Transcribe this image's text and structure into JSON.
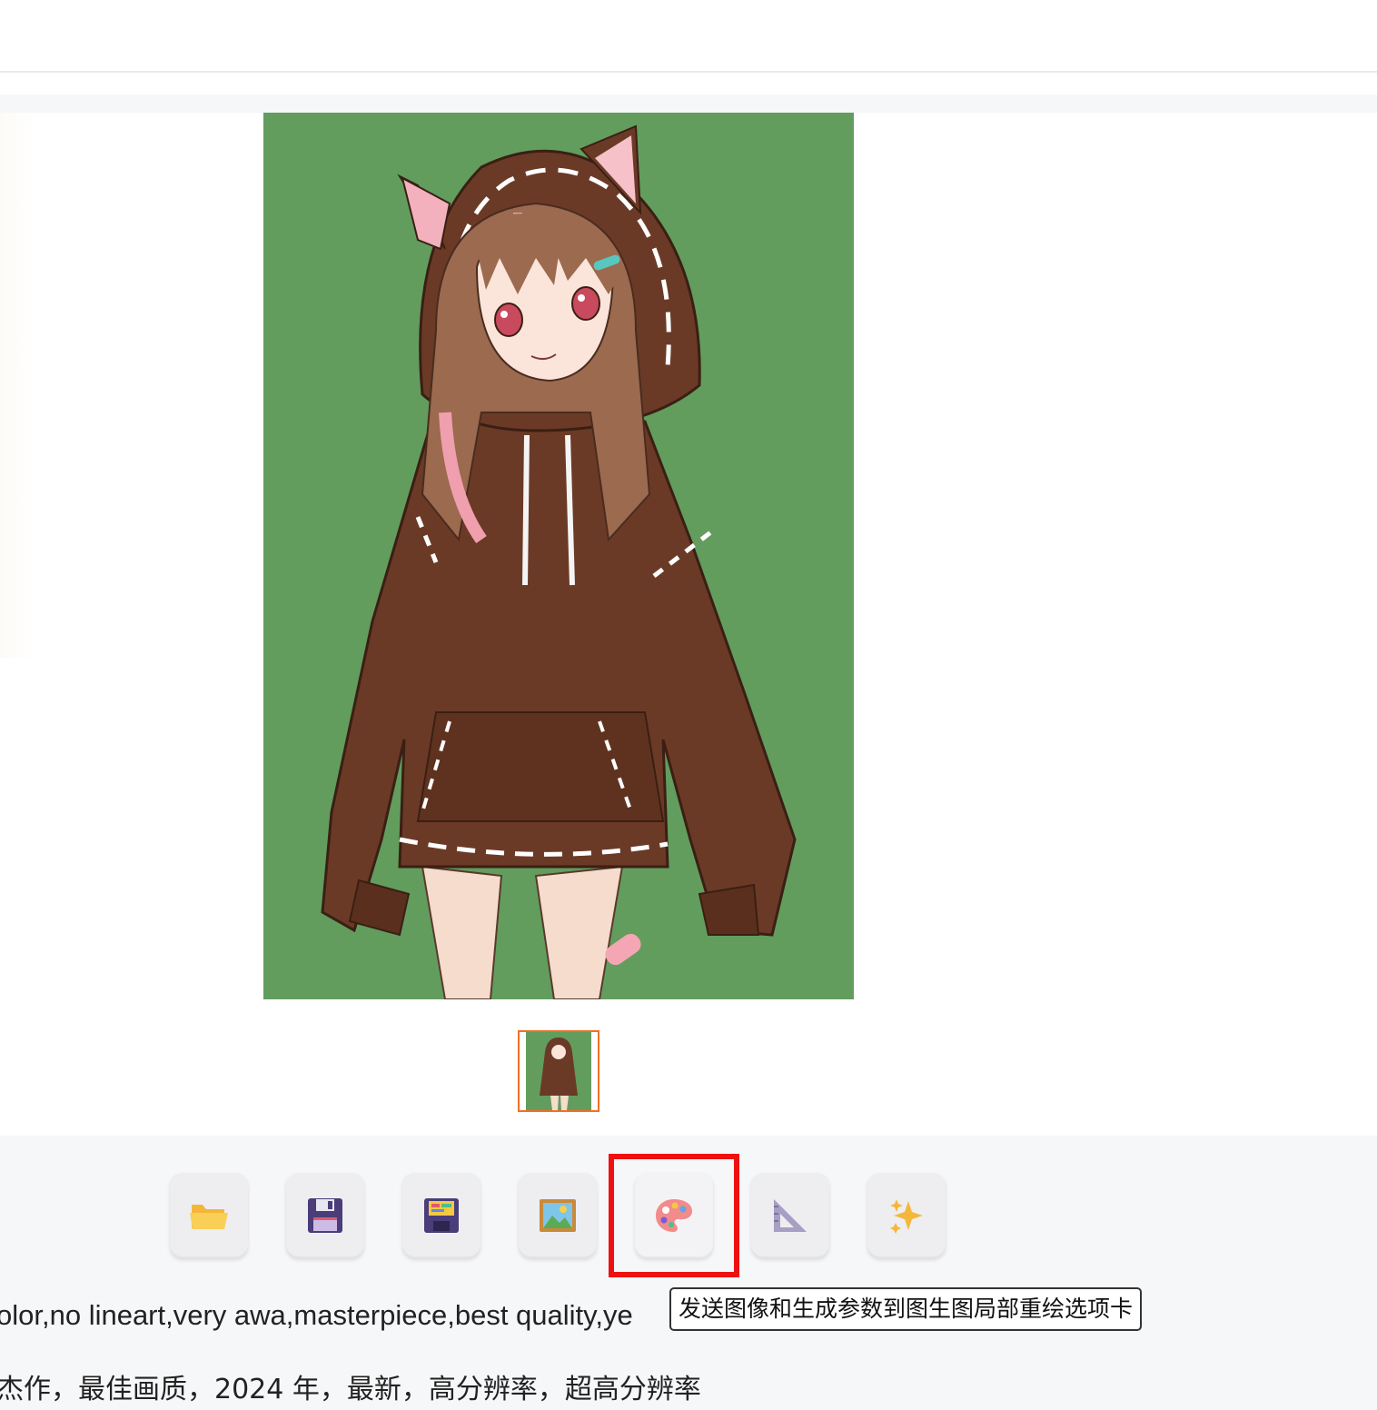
{
  "gallery": {
    "selected_index": 0,
    "image_count": 1
  },
  "toolbar": {
    "buttons": [
      {
        "icon": "folder-icon"
      },
      {
        "icon": "save-floppy-icon"
      },
      {
        "icon": "save-zip-floppy-icon"
      },
      {
        "icon": "picture-icon"
      },
      {
        "icon": "palette-icon"
      },
      {
        "icon": "triangular-ruler-icon"
      },
      {
        "icon": "sparkles-icon"
      }
    ],
    "active_index": 4,
    "tooltip": "发送图像和生成参数到图生图局部重绘选项卡"
  },
  "prompt": {
    "line1": "olor,no lineart,very awa,masterpiece,best quality,ye",
    "line2": "杰作，最佳画质，2024 年，最新，高分辨率，超高分辨率"
  },
  "colors": {
    "image_background": "#629d5e",
    "thumbnail_border": "#f07025",
    "highlight_box": "#ee1111"
  }
}
